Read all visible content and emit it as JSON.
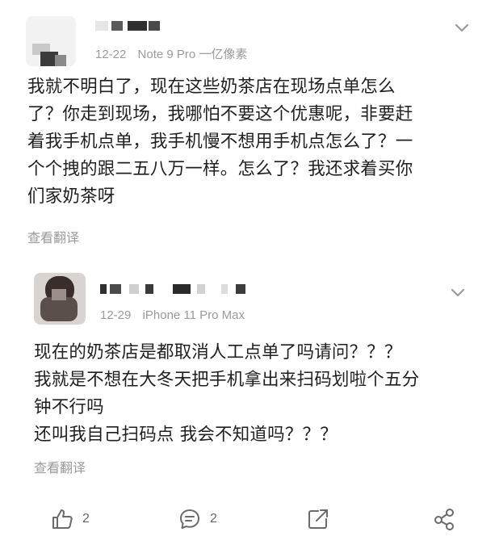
{
  "comments": [
    {
      "date": "12-22",
      "device": "Note 9 Pro 一亿像素",
      "lines": [
        "我就不明白了，现在这些奶茶店在现场点单怎么",
        "了？你走到现场，我哪怕不要这个优惠呢，非要赶",
        "着我手机点单，我手机慢不想用手机点怎么了？一",
        "个个拽的跟二五八万一样。怎么了？我还求着买你",
        "们家奶茶呀"
      ],
      "translate_label": "查看翻译"
    },
    {
      "date": "12-29",
      "device": "iPhone 11 Pro Max",
      "lines": [
        "现在的奶茶店是都取消人工点单了吗请问？？？",
        "我就是不想在大冬天把手机拿出来扫码划啦个五分",
        "钟不行吗",
        "还叫我自己扫码点 我会不知道吗？？？"
      ],
      "translate_label": "查看翻译"
    }
  ],
  "actions": {
    "like_count": "2",
    "comment_count": "2"
  },
  "icons": {
    "more": "chevron-down-icon",
    "like": "thumbs-up-icon",
    "comment": "comment-bubble-icon",
    "share": "share-icon",
    "more_share": "network-share-icon"
  },
  "colors": {
    "text": "#1f1f1f",
    "meta": "#9a9a9a",
    "icon": "#6b6b6b"
  }
}
